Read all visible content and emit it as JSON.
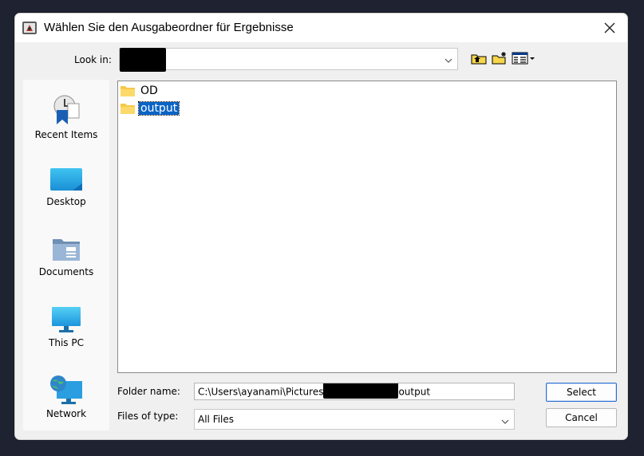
{
  "window": {
    "title": "Wählen Sie den Ausgabeordner für Ergebnisse",
    "app_icon": "java-app-icon",
    "close_icon": "close-icon"
  },
  "lookin": {
    "label": "Look in:",
    "value": "",
    "chevron_icon": "chevron-down-icon"
  },
  "toolbar": {
    "up_icon": "folder-up-icon",
    "new_folder_icon": "new-folder-icon",
    "view_menu_icon": "details-view-icon"
  },
  "places": [
    {
      "label": "Recent Items",
      "icon": "recent-items-icon"
    },
    {
      "label": "Desktop",
      "icon": "desktop-icon"
    },
    {
      "label": "Documents",
      "icon": "documents-icon"
    },
    {
      "label": "This PC",
      "icon": "this-pc-icon"
    },
    {
      "label": "Network",
      "icon": "network-icon"
    }
  ],
  "files": [
    {
      "name": "OD",
      "icon": "folder-icon",
      "selected": false
    },
    {
      "name": "output",
      "icon": "folder-icon",
      "selected": true
    }
  ],
  "folder_name": {
    "label": "Folder name:",
    "value_prefix": "C:\\Users\\ayanami\\Pictures",
    "value_suffix": "output"
  },
  "file_type": {
    "label": "Files of type:",
    "value": "All Files"
  },
  "buttons": {
    "select": "Select",
    "cancel": "Cancel"
  },
  "colors": {
    "selection": "#0a64c6",
    "primary_border": "#2a6fd2",
    "backdrop": "#1f2230"
  }
}
